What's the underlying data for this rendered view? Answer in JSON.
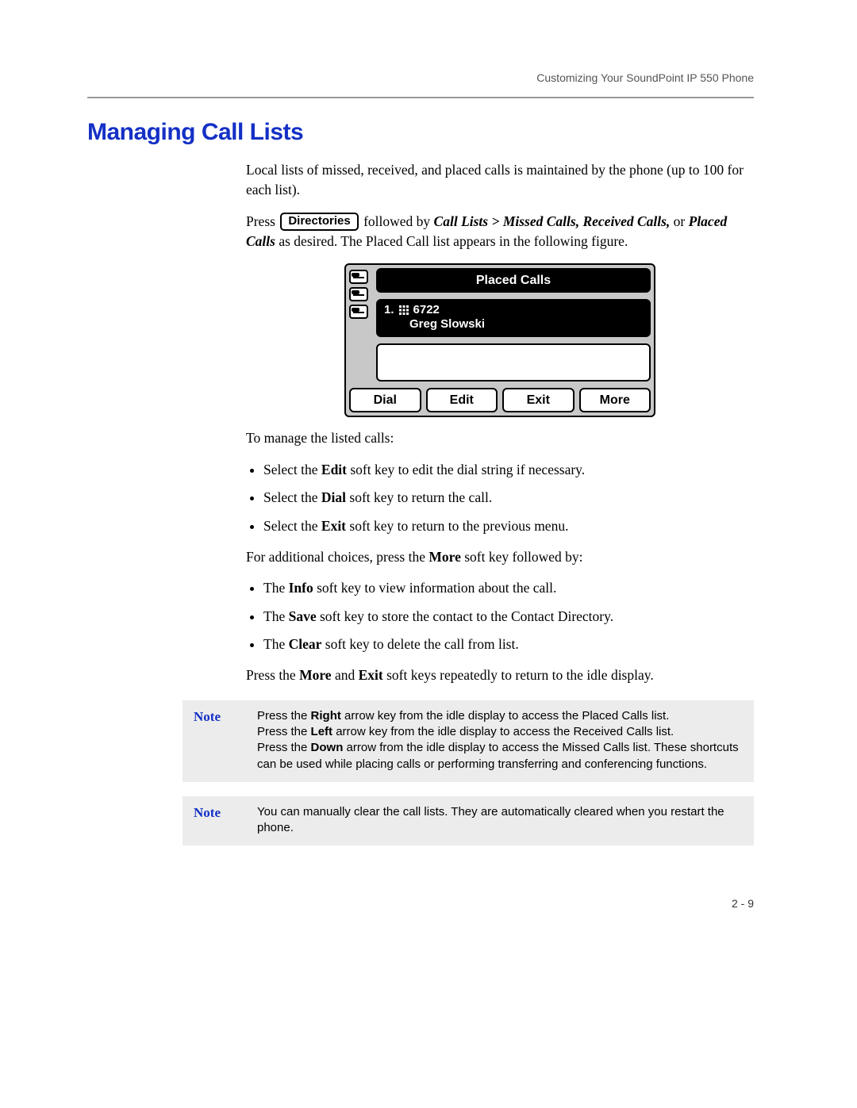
{
  "header": {
    "running": "Customizing Your SoundPoint IP 550 Phone"
  },
  "title": "Managing Call Lists",
  "intro": "Local lists of missed, received, and placed calls is maintained by the phone (up to 100 for each list).",
  "press_line": {
    "pre": "Press",
    "button": "Directories",
    "mid": "followed by ",
    "path": "Call Lists > Missed Calls, Received Calls,",
    "or": " or ",
    "placed": "Placed Calls",
    "post": " as desired. The Placed Call list appears in the following figure."
  },
  "phone": {
    "title": "Placed Calls",
    "entry_index": "1.",
    "entry_number": "6722",
    "entry_name": "Greg Slowski",
    "softkeys": [
      "Dial",
      "Edit",
      "Exit",
      "More"
    ]
  },
  "manage_intro": "To manage the listed calls:",
  "manage": [
    {
      "pre": "Select the ",
      "b": "Edit",
      "post": " soft key to edit the dial string if necessary."
    },
    {
      "pre": "Select the ",
      "b": "Dial",
      "post": " soft key to return the call."
    },
    {
      "pre": "Select the ",
      "b": "Exit",
      "post": " soft key to return to the previous menu."
    }
  ],
  "more_intro": {
    "pre": "For additional choices, press the ",
    "b": "More",
    "post": " soft key followed by:"
  },
  "more_list": [
    {
      "pre": "The ",
      "b": "Info",
      "post": " soft key to view information about the call."
    },
    {
      "pre": "The ",
      "b": "Save",
      "post": " soft key to store the contact to the Contact Directory."
    },
    {
      "pre": "The ",
      "b": "Clear",
      "post": " soft key to delete the call from list."
    }
  ],
  "return_line": {
    "pre": "Press the ",
    "b1": "More",
    "mid": " and ",
    "b2": "Exit",
    "post": " soft keys repeatedly to return to the idle display."
  },
  "notes": {
    "label": "Note",
    "n1": {
      "l1a": "Press the ",
      "l1b": "Right",
      "l1c": " arrow key from the idle display to access the Placed Calls list.",
      "l2a": "Press the ",
      "l2b": "Left",
      "l2c": " arrow key from the idle display to access the Received Calls list.",
      "l3a": "Press the ",
      "l3b": "Down",
      "l3c": " arrow from the idle display to access the Missed Calls list. These shortcuts can be used while placing calls or performing transferring and conferencing functions."
    },
    "n2": "You can manually clear the call lists. They are automatically cleared when you restart the phone."
  },
  "page_number": "2 - 9"
}
